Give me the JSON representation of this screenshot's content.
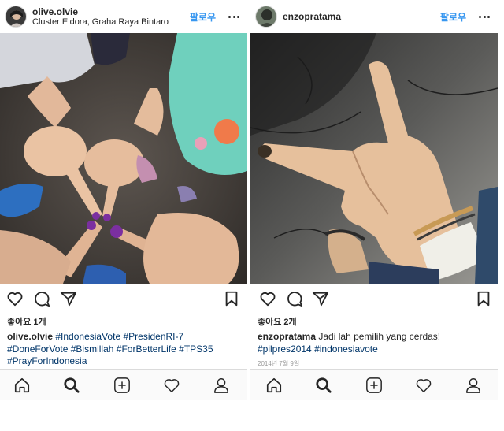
{
  "posts": [
    {
      "username": "olive.olvie",
      "location": "Cluster Eldora, Graha Raya Bintaro",
      "follow_label": "팔로우",
      "likes": "좋아요 1개",
      "caption_user": "olive.olvie",
      "caption_lines": [
        [
          "#IndonesiaVote",
          "#PresidenRI-7"
        ],
        [
          "#DoneForVote",
          "#Bismillah",
          "#ForBetterLife",
          "#TPS35"
        ],
        [
          "#PrayForIndonesia"
        ]
      ],
      "date": ""
    },
    {
      "username": "enzopratama",
      "location": "",
      "follow_label": "팔로우",
      "likes": "좋아요 2개",
      "caption_user": "enzopratama",
      "caption_text": "Jadi lah pemilih yang cerdas!",
      "caption_tags": [
        "#pilpres2014",
        "#indonesiavote"
      ],
      "date": "2014년 7월 9일"
    }
  ],
  "icons": {
    "header": [
      "avatar",
      "more-options-icon"
    ],
    "actions": [
      "heart-icon",
      "comment-icon",
      "share-icon",
      "bookmark-icon"
    ],
    "tabbar": [
      "home-icon",
      "search-icon",
      "add-post-icon",
      "activity-heart-icon",
      "profile-icon"
    ]
  },
  "colors": {
    "link": "#003569",
    "follow": "#3897f0",
    "text": "#262626",
    "muted": "#999999",
    "divider": "#dbdbdb",
    "tabbar_bg": "#fafafa"
  }
}
